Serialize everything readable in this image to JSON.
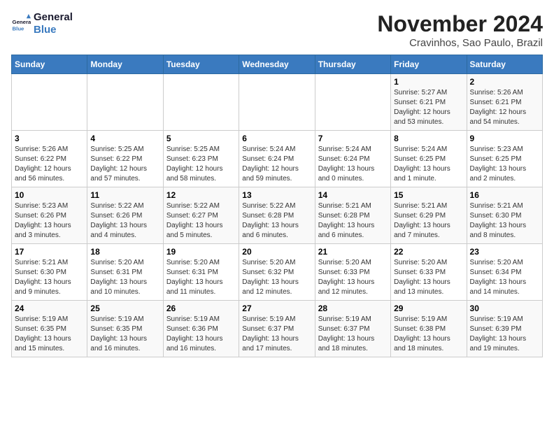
{
  "logo": {
    "line1": "General",
    "line2": "Blue"
  },
  "title": "November 2024",
  "location": "Cravinhos, Sao Paulo, Brazil",
  "weekdays": [
    "Sunday",
    "Monday",
    "Tuesday",
    "Wednesday",
    "Thursday",
    "Friday",
    "Saturday"
  ],
  "weeks": [
    [
      {
        "day": "",
        "info": ""
      },
      {
        "day": "",
        "info": ""
      },
      {
        "day": "",
        "info": ""
      },
      {
        "day": "",
        "info": ""
      },
      {
        "day": "",
        "info": ""
      },
      {
        "day": "1",
        "info": "Sunrise: 5:27 AM\nSunset: 6:21 PM\nDaylight: 12 hours and 53 minutes."
      },
      {
        "day": "2",
        "info": "Sunrise: 5:26 AM\nSunset: 6:21 PM\nDaylight: 12 hours and 54 minutes."
      }
    ],
    [
      {
        "day": "3",
        "info": "Sunrise: 5:26 AM\nSunset: 6:22 PM\nDaylight: 12 hours and 56 minutes."
      },
      {
        "day": "4",
        "info": "Sunrise: 5:25 AM\nSunset: 6:22 PM\nDaylight: 12 hours and 57 minutes."
      },
      {
        "day": "5",
        "info": "Sunrise: 5:25 AM\nSunset: 6:23 PM\nDaylight: 12 hours and 58 minutes."
      },
      {
        "day": "6",
        "info": "Sunrise: 5:24 AM\nSunset: 6:24 PM\nDaylight: 12 hours and 59 minutes."
      },
      {
        "day": "7",
        "info": "Sunrise: 5:24 AM\nSunset: 6:24 PM\nDaylight: 13 hours and 0 minutes."
      },
      {
        "day": "8",
        "info": "Sunrise: 5:24 AM\nSunset: 6:25 PM\nDaylight: 13 hours and 1 minute."
      },
      {
        "day": "9",
        "info": "Sunrise: 5:23 AM\nSunset: 6:25 PM\nDaylight: 13 hours and 2 minutes."
      }
    ],
    [
      {
        "day": "10",
        "info": "Sunrise: 5:23 AM\nSunset: 6:26 PM\nDaylight: 13 hours and 3 minutes."
      },
      {
        "day": "11",
        "info": "Sunrise: 5:22 AM\nSunset: 6:26 PM\nDaylight: 13 hours and 4 minutes."
      },
      {
        "day": "12",
        "info": "Sunrise: 5:22 AM\nSunset: 6:27 PM\nDaylight: 13 hours and 5 minutes."
      },
      {
        "day": "13",
        "info": "Sunrise: 5:22 AM\nSunset: 6:28 PM\nDaylight: 13 hours and 6 minutes."
      },
      {
        "day": "14",
        "info": "Sunrise: 5:21 AM\nSunset: 6:28 PM\nDaylight: 13 hours and 6 minutes."
      },
      {
        "day": "15",
        "info": "Sunrise: 5:21 AM\nSunset: 6:29 PM\nDaylight: 13 hours and 7 minutes."
      },
      {
        "day": "16",
        "info": "Sunrise: 5:21 AM\nSunset: 6:30 PM\nDaylight: 13 hours and 8 minutes."
      }
    ],
    [
      {
        "day": "17",
        "info": "Sunrise: 5:21 AM\nSunset: 6:30 PM\nDaylight: 13 hours and 9 minutes."
      },
      {
        "day": "18",
        "info": "Sunrise: 5:20 AM\nSunset: 6:31 PM\nDaylight: 13 hours and 10 minutes."
      },
      {
        "day": "19",
        "info": "Sunrise: 5:20 AM\nSunset: 6:31 PM\nDaylight: 13 hours and 11 minutes."
      },
      {
        "day": "20",
        "info": "Sunrise: 5:20 AM\nSunset: 6:32 PM\nDaylight: 13 hours and 12 minutes."
      },
      {
        "day": "21",
        "info": "Sunrise: 5:20 AM\nSunset: 6:33 PM\nDaylight: 13 hours and 12 minutes."
      },
      {
        "day": "22",
        "info": "Sunrise: 5:20 AM\nSunset: 6:33 PM\nDaylight: 13 hours and 13 minutes."
      },
      {
        "day": "23",
        "info": "Sunrise: 5:20 AM\nSunset: 6:34 PM\nDaylight: 13 hours and 14 minutes."
      }
    ],
    [
      {
        "day": "24",
        "info": "Sunrise: 5:19 AM\nSunset: 6:35 PM\nDaylight: 13 hours and 15 minutes."
      },
      {
        "day": "25",
        "info": "Sunrise: 5:19 AM\nSunset: 6:35 PM\nDaylight: 13 hours and 16 minutes."
      },
      {
        "day": "26",
        "info": "Sunrise: 5:19 AM\nSunset: 6:36 PM\nDaylight: 13 hours and 16 minutes."
      },
      {
        "day": "27",
        "info": "Sunrise: 5:19 AM\nSunset: 6:37 PM\nDaylight: 13 hours and 17 minutes."
      },
      {
        "day": "28",
        "info": "Sunrise: 5:19 AM\nSunset: 6:37 PM\nDaylight: 13 hours and 18 minutes."
      },
      {
        "day": "29",
        "info": "Sunrise: 5:19 AM\nSunset: 6:38 PM\nDaylight: 13 hours and 18 minutes."
      },
      {
        "day": "30",
        "info": "Sunrise: 5:19 AM\nSunset: 6:39 PM\nDaylight: 13 hours and 19 minutes."
      }
    ]
  ]
}
